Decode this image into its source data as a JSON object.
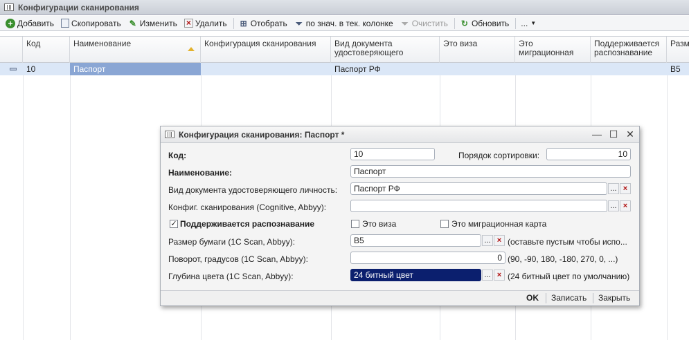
{
  "main_window": {
    "title": "Конфигурации сканирования"
  },
  "toolbar": {
    "add": "Добавить",
    "copy": "Скопировать",
    "edit": "Изменить",
    "delete": "Удалить",
    "filter": "Отобрать",
    "filter_by_value": "по знач. в тек. колонке",
    "clear": "Очистить",
    "refresh": "Обновить",
    "more": "..."
  },
  "grid": {
    "columns": [
      "Код",
      "Наименование",
      "Конфигурация сканирования",
      "Вид документа удостоверяющего",
      "Это виза",
      "Это миграционная",
      "Поддерживается распознавание",
      "Разм"
    ],
    "rows": [
      {
        "code": "10",
        "name": "Паспорт",
        "config": "",
        "doc_type": "Паспорт РФ",
        "is_visa": "",
        "is_migration": "",
        "recognition": "",
        "size": "B5"
      }
    ]
  },
  "dialog": {
    "title": "Конфигурация сканирования: Паспорт *",
    "code_label": "Код:",
    "code_value": "10",
    "sort_label": "Порядок сортировки:",
    "sort_value": "10",
    "name_label": "Наименование:",
    "name_value": "Паспорт",
    "doc_type_label": "Вид документа удостоверяющего личность:",
    "doc_type_value": "Паспорт РФ",
    "config_label": "Конфиг. сканирования (Cognitive, Abbyy):",
    "config_value": "",
    "recognition_label": "Поддерживается распознавание",
    "recognition_checked": true,
    "visa_label": "Это виза",
    "visa_checked": false,
    "migration_label": "Это миграционная карта",
    "migration_checked": false,
    "paper_label": "Размер бумаги (1C Scan, Abbyy):",
    "paper_value": "B5",
    "paper_hint": "(оставьте пустым чтобы испо...",
    "rotation_label": "Поворот, градусов (1C Scan, Abbyy):",
    "rotation_value": "0",
    "rotation_hint": "(90, -90, 180, -180, 270, 0, ...)",
    "depth_label": "Глубина цвета (1C Scan, Abbyy):",
    "depth_value": "24 битный цвет",
    "depth_hint": "(24 битный цвет по умолчанию)",
    "ok": "OK",
    "save": "Записать",
    "close": "Закрыть",
    "select_btn": "...",
    "clear_btn": "×"
  },
  "colors": {
    "selection": "#0b1f6e",
    "row_highlight": "#dbe7f7",
    "accent_green": "#3a8f2e",
    "delete_red": "#b01010"
  }
}
